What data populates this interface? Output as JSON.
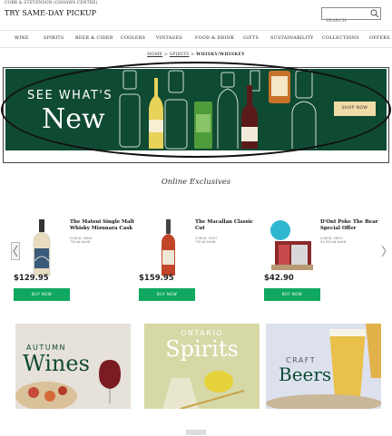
{
  "header": {
    "store_line": "COBB & STEVENSON (OSHAWA CENTRE)",
    "pickup": "TRY SAME-DAY PICKUP",
    "search_placeholder": "SEARCH"
  },
  "nav": [
    "WINE",
    "SPIRITS",
    "BEER & CIDER",
    "COOLERS",
    "VINTAGES",
    "FOOD & DRINK",
    "GIFTS",
    "SUSTAINABILITY",
    "COLLECTIONS",
    "OFFERS"
  ],
  "breadcrumb": {
    "home": "HOME",
    "sep": ">",
    "spirits": "SPIRITS",
    "current": "WHISKY/WHISKEY"
  },
  "banner": {
    "line1": "SEE WHAT'S",
    "line2": "New",
    "button": "SHOP NOW",
    "bg_color": "#0f4a33"
  },
  "section_title": "Online Exclusives",
  "products": [
    {
      "name": "The Matsui Single Malt Whisky Mizunara Cask",
      "meta1": "LCBO#: 14606",
      "meta2": "750 mL bottle",
      "price": "$129.95",
      "button": "BUY NOW"
    },
    {
      "name": "The Macallan Classic Cut",
      "meta1": "LCBO#: 15937",
      "meta2": "750 mL bottle",
      "price": "$159.95",
      "button": "BUY NOW"
    },
    {
      "name": "D'Ont Poke The Bear Special Offer",
      "meta1": "LCBO#: 14899",
      "meta2": "4 x 355 mL bottle",
      "price": "$42.90",
      "button": "BUY NOW"
    }
  ],
  "tiles": [
    {
      "small": "AUTUMN",
      "big": "Wines"
    },
    {
      "small": "ONTARIO",
      "big": "Spirits"
    },
    {
      "small": "CRAFT",
      "big": "Beers"
    }
  ],
  "accent_green": "#10a860"
}
